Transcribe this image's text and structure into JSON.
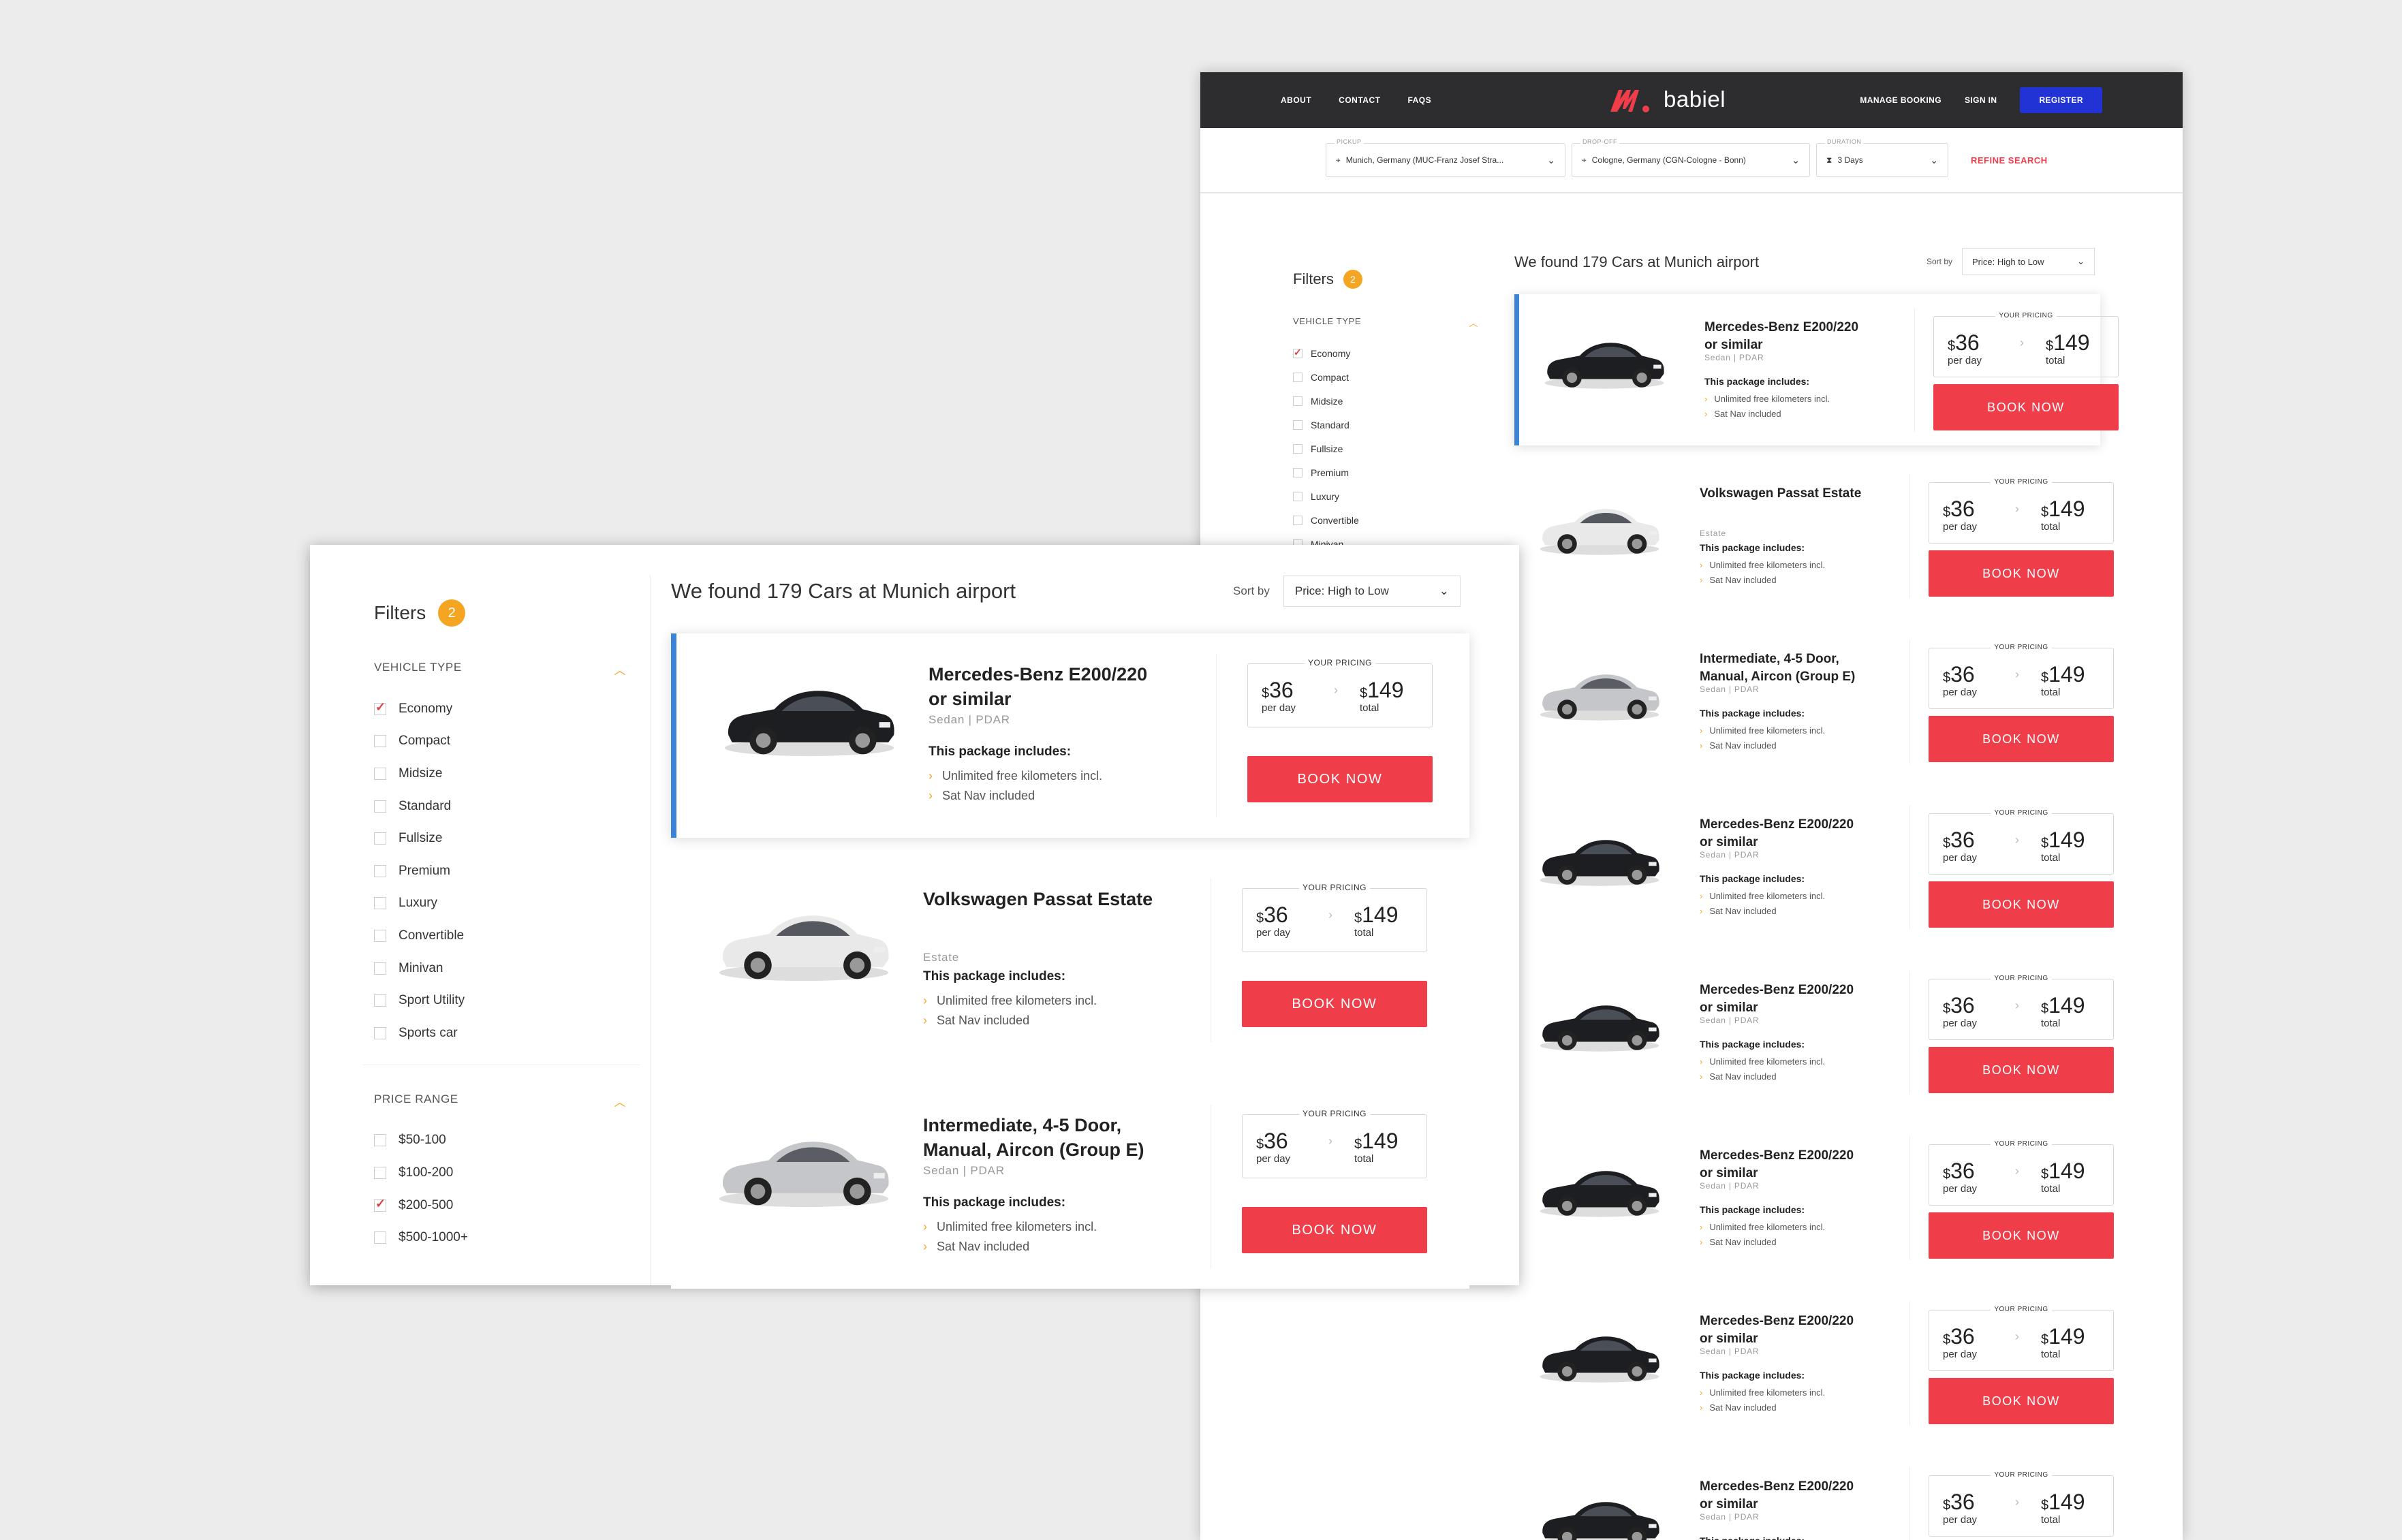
{
  "brand": {
    "name": "babiel",
    "color": "#ef3e4a"
  },
  "nav": {
    "links": [
      "ABOUT",
      "CONTACT",
      "FAQS"
    ],
    "manage": "MANAGE BOOKING",
    "signin": "SIGN IN",
    "register": "REGISTER"
  },
  "search": {
    "pickup_label": "PICKUP",
    "pickup_value": "Munich, Germany (MUC-Franz Josef Stra...",
    "dropoff_label": "DROP-OFF",
    "dropoff_value": "Cologne, Germany (CGN-Cologne - Bonn)",
    "duration_label": "DURATION",
    "duration_value": "3 Days",
    "refine": "REFINE SEARCH"
  },
  "filters": {
    "title": "Filters",
    "count": "2",
    "vehicle_type_title": "VEHICLE TYPE",
    "vehicle_types": [
      "Economy",
      "Compact",
      "Midsize",
      "Standard",
      "Fullsize",
      "Premium",
      "Luxury",
      "Convertible",
      "Minivan",
      "Sport Utility",
      "Sports car"
    ],
    "price_range_title": "PRICE RANGE",
    "price_ranges": [
      "$50-100",
      "$100-200",
      "$200-500",
      "$500-1000+"
    ]
  },
  "results": {
    "heading": "We found 179 Cars at Munich airport",
    "sort_label": "Sort by",
    "sort_value": "Price: High to Low"
  },
  "common": {
    "includes_title": "This package includes:",
    "inc1": "Unlimited free kilometers incl.",
    "inc2": "Sat Nav included",
    "your_pricing": "YOUR PRICING",
    "currency": "$",
    "per_day": "per day",
    "total": "total",
    "book": "BOOK NOW"
  },
  "cars": [
    {
      "name1": "Mercedes-Benz E200/220",
      "name2": "or similar",
      "sub": "Sedan | PDAR",
      "day": "36",
      "total": "149",
      "color": "dark"
    },
    {
      "name1": "Volkswagen Passat Estate",
      "name2": "",
      "sub": "Estate",
      "day": "36",
      "total": "149",
      "color": "white"
    },
    {
      "name1": "Intermediate, 4-5 Door,",
      "name2": "Manual, Aircon (Group E)",
      "sub": "Sedan | PDAR",
      "day": "36",
      "total": "149",
      "color": "silver"
    },
    {
      "name1": "Mercedes-Benz E200/220",
      "name2": "or similar",
      "sub": "Sedan | PDAR",
      "day": "36",
      "total": "149",
      "color": "dark"
    },
    {
      "name1": "Mercedes-Benz E200/220",
      "name2": "or similar",
      "sub": "Sedan | PDAR",
      "day": "36",
      "total": "149",
      "color": "dark"
    },
    {
      "name1": "Mercedes-Benz E200/220",
      "name2": "or similar",
      "sub": "Sedan | PDAR",
      "day": "36",
      "total": "149",
      "color": "dark"
    },
    {
      "name1": "Mercedes-Benz E200/220",
      "name2": "or similar",
      "sub": "Sedan | PDAR",
      "day": "36",
      "total": "149",
      "color": "dark"
    },
    {
      "name1": "Mercedes-Benz E200/220",
      "name2": "or similar",
      "sub": "Sedan | PDAR",
      "day": "36",
      "total": "149",
      "color": "dark"
    }
  ]
}
